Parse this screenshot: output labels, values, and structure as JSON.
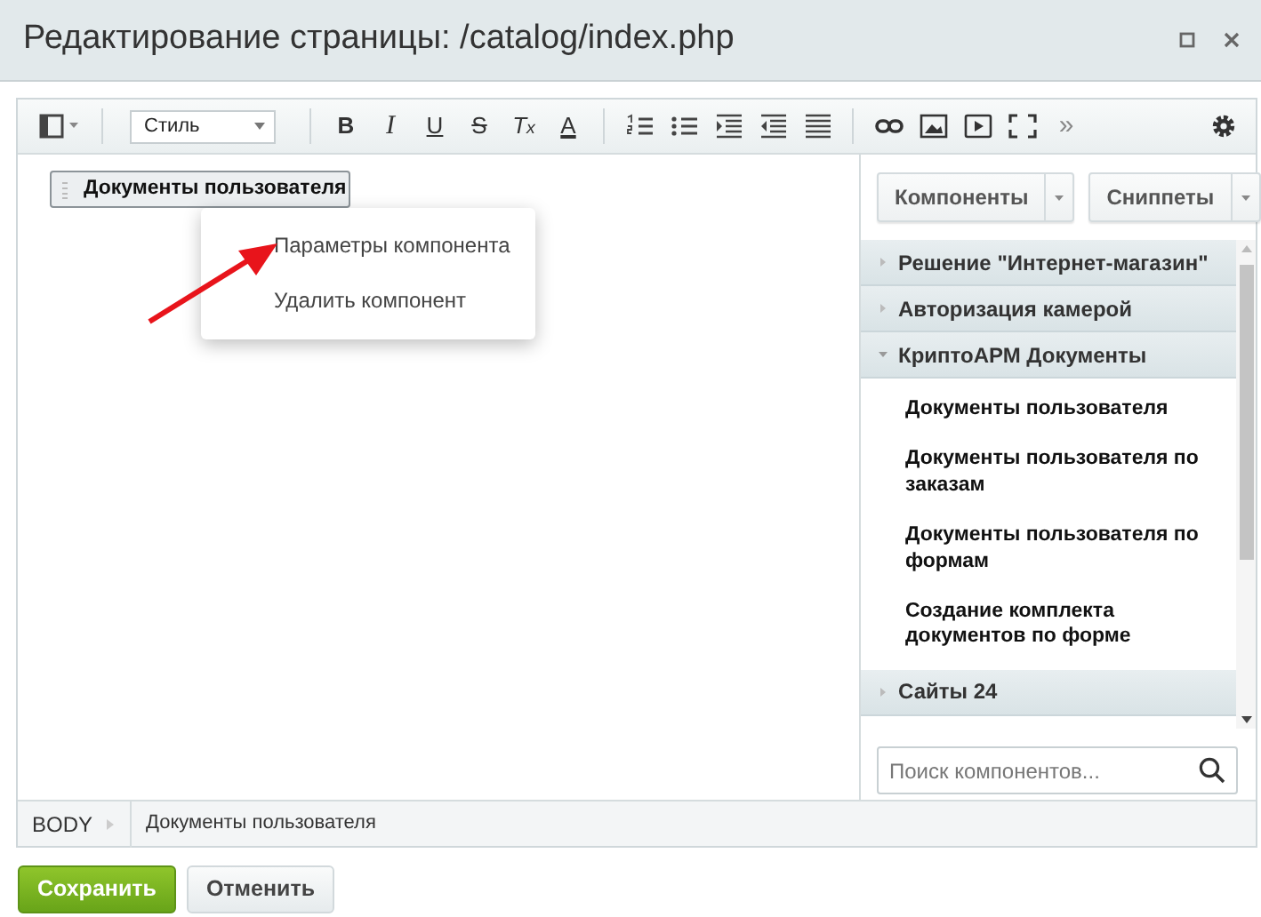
{
  "window": {
    "title": "Редактирование страницы: /catalog/index.php"
  },
  "toolbar": {
    "style_select": "Стиль",
    "format_buttons": [
      {
        "label": "B"
      },
      {
        "label": "I"
      },
      {
        "label": "U"
      },
      {
        "label": "S"
      },
      {
        "label": "T$_{x}$"
      },
      {
        "label": "A"
      }
    ],
    "more": "»"
  },
  "editor": {
    "component": "Документы пользователя",
    "context_menu": [
      {
        "label": "Параметры компонента"
      },
      {
        "label": "Удалить компонент"
      }
    ]
  },
  "panel": {
    "buttons": [
      "Компоненты",
      "Сниппеты"
    ],
    "groups": [
      {
        "label": "Решение \"Интернет-магазин\"",
        "expanded": false
      },
      {
        "label": "Авторизация камерой",
        "expanded": false
      },
      {
        "label": "КриптоАРМ Документы",
        "expanded": true,
        "children": [
          {
            "label": "Документы пользователя"
          },
          {
            "label": "Документы пользователя по заказам"
          },
          {
            "label": "Документы пользователя по формам"
          },
          {
            "label": "Создание комплекта документов по форме"
          }
        ]
      },
      {
        "label": "Сайты 24",
        "expanded": false
      }
    ],
    "search": {
      "placeholder": "Поиск компонентов..."
    }
  },
  "status_bar": [
    "BODY",
    "Документы пользователя"
  ],
  "buttons": [
    {
      "label": "Сохранить",
      "kind": "primary"
    },
    {
      "label": "Отменить",
      "kind": "secondary"
    }
  ]
}
